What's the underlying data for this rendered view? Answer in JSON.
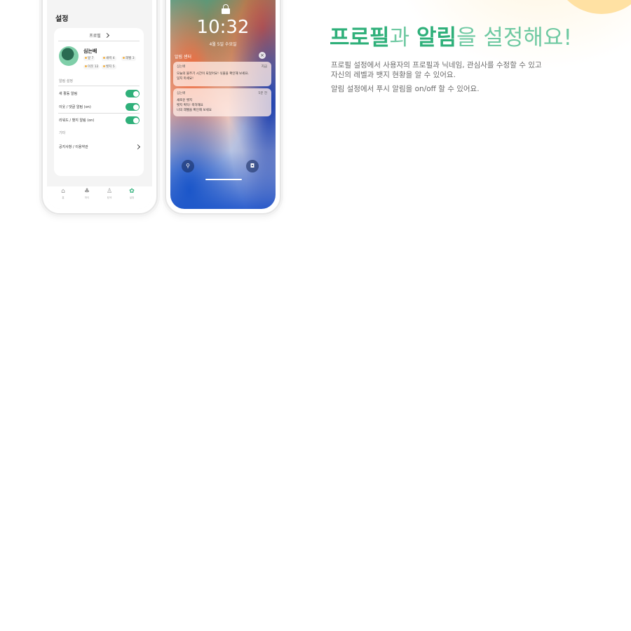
{
  "headline": {
    "p1": "프로필",
    "p2": "과 ",
    "p3": "알림",
    "p4": "을 설정해요!"
  },
  "description": {
    "line1": "프로필 설정에서 사용자의 프로필과 닉네임, 관심사를 수정할 수 있고",
    "line2": "자신의 레벨과 뱃지 현황을 알 수 있어요.",
    "line3": "알림 설정에서 푸시 알림을 on/off 할 수 있어요."
  },
  "settings_screen": {
    "title": "설정",
    "card_header": "프로필",
    "profile_name": "심는배",
    "chips": [
      "잎 7",
      "새싹 4",
      "레벨 3",
      "이웃 12",
      "뱃지 5"
    ],
    "section_notifications": "알림 설정",
    "rows": [
      "새 활동 알림",
      "이웃 / 댓글 알림 (on)",
      "리워드 / 뱃지 알림 (on)"
    ],
    "section_etc": "기타",
    "etc_row": "공지사항 / 이용약관",
    "tabs": [
      "홈",
      "마이",
      "탐색",
      "설정"
    ],
    "tab_icons": [
      "home-icon",
      "plant-icon",
      "basket-icon",
      "settings-icon"
    ],
    "accent_color": "#2fb07a"
  },
  "lock_screen": {
    "time": "10:32",
    "date": "4월 5일 수요일",
    "notif_header": "알림 센터",
    "notifications": [
      {
        "app": "심는배",
        "time": "지금",
        "line1": "오늘의 물주기 시간이 되었어요! 식물을 확인해 보세요.",
        "line2": "잊지 마세요!"
      },
      {
        "app": "심는배",
        "time": "5분 전",
        "line1": "새로운 뱃지",
        "line2": "뱃지 획득! 축하해요",
        "line3": "나의 레벨을 확인해 보세요"
      }
    ]
  }
}
